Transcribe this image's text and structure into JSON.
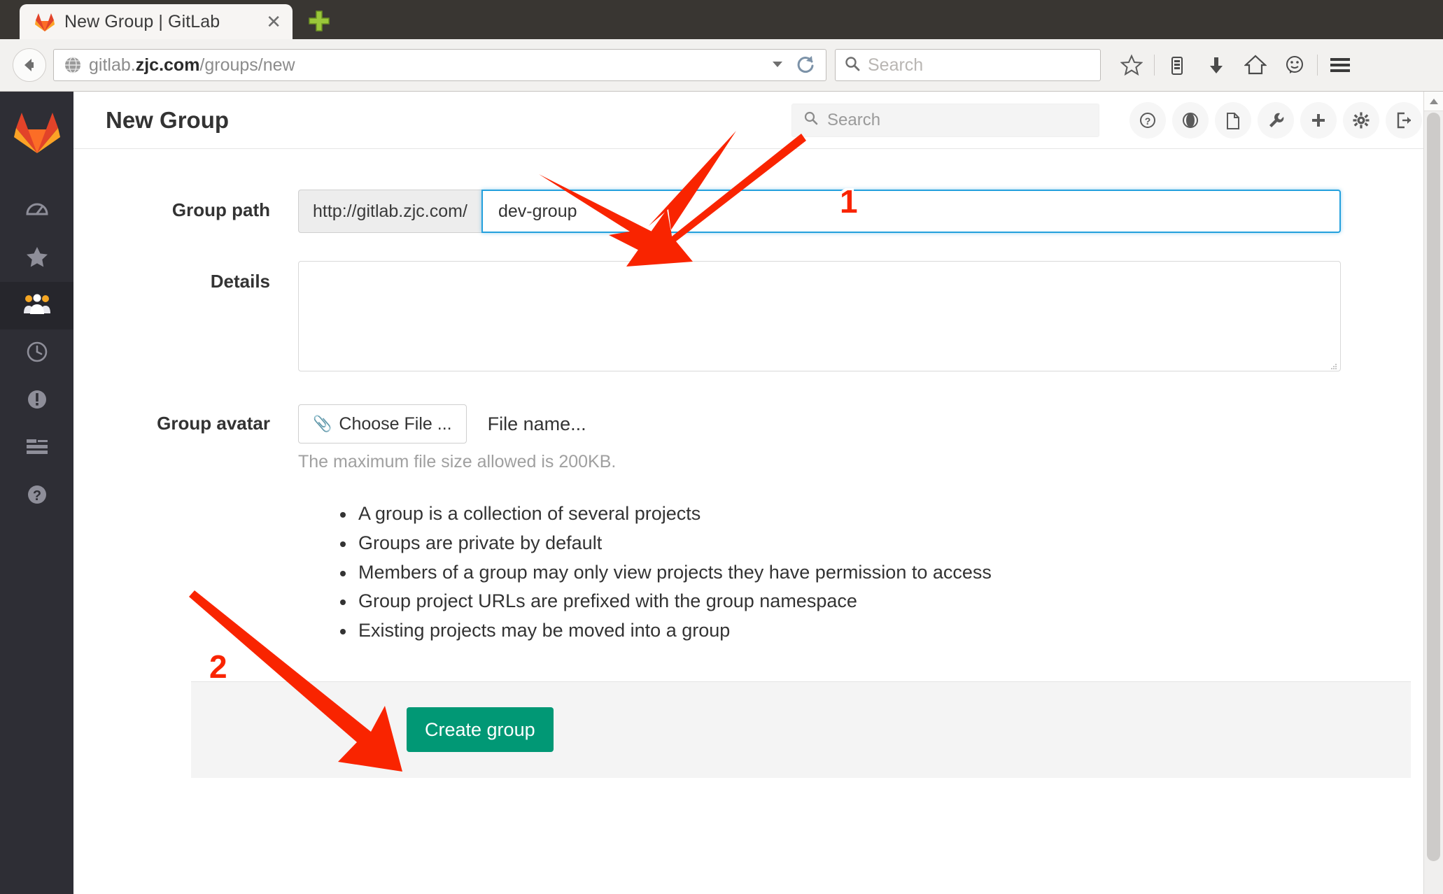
{
  "browser": {
    "tab": {
      "title": "New Group | GitLab",
      "favicon": "gitlab-fox-icon",
      "close_label": "✕"
    },
    "new_tab_label": "+",
    "back_label": "←",
    "url": {
      "prefix": "gitlab.",
      "domain": "zjc.com",
      "path": "/groups/new",
      "full": "gitlab.zjc.com/groups/new"
    },
    "search": {
      "placeholder": "Search"
    },
    "toolbar_icons": [
      "bookmark-star-icon",
      "library-icon",
      "downloads-icon",
      "home-icon",
      "feedback-smiley-icon",
      "hamburger-menu-icon"
    ]
  },
  "sidebar": {
    "logo": "gitlab-logo-icon",
    "items": [
      {
        "name": "dashboard",
        "icon": "speedometer-icon",
        "active": false
      },
      {
        "name": "starred-projects",
        "icon": "star-icon",
        "active": false
      },
      {
        "name": "groups",
        "icon": "group-users-icon",
        "active": true
      },
      {
        "name": "activity",
        "icon": "clock-icon",
        "active": false
      },
      {
        "name": "issues",
        "icon": "exclamation-circle-icon",
        "active": false
      },
      {
        "name": "milestones",
        "icon": "list-lines-icon",
        "active": false
      },
      {
        "name": "help",
        "icon": "question-circle-icon",
        "active": false
      }
    ]
  },
  "header": {
    "title": "New Group",
    "search_placeholder": "Search",
    "icons": [
      "help-icon",
      "public-globe-icon",
      "snippets-icon",
      "admin-wrench-icon",
      "new-plus-icon",
      "settings-gear-icon",
      "sign-out-icon"
    ]
  },
  "form": {
    "group_path": {
      "label": "Group path",
      "prefix": "http://gitlab.zjc.com/",
      "value": "dev-group",
      "placeholder": "",
      "focused": true
    },
    "details": {
      "label": "Details",
      "value": "",
      "placeholder": ""
    },
    "avatar": {
      "label": "Group avatar",
      "choose_button": "Choose File ...",
      "file_name": "File name...",
      "hint": "The maximum file size allowed is 200KB."
    },
    "bullets": [
      "A group is a collection of several projects",
      "Groups are private by default",
      "Members of a group may only view projects they have permission to access",
      "Group project URLs are prefixed with the group namespace",
      "Existing projects may be moved into a group"
    ],
    "submit_label": "Create group"
  },
  "annotations": [
    {
      "number": "1",
      "target": "group-path-input"
    },
    {
      "number": "2",
      "target": "create-group-button"
    }
  ],
  "colors": {
    "accent_green": "#019875",
    "annotation_red": "#f92400",
    "focus_blue": "#24a0dd",
    "sidebar_dark": "#2e2e35"
  }
}
